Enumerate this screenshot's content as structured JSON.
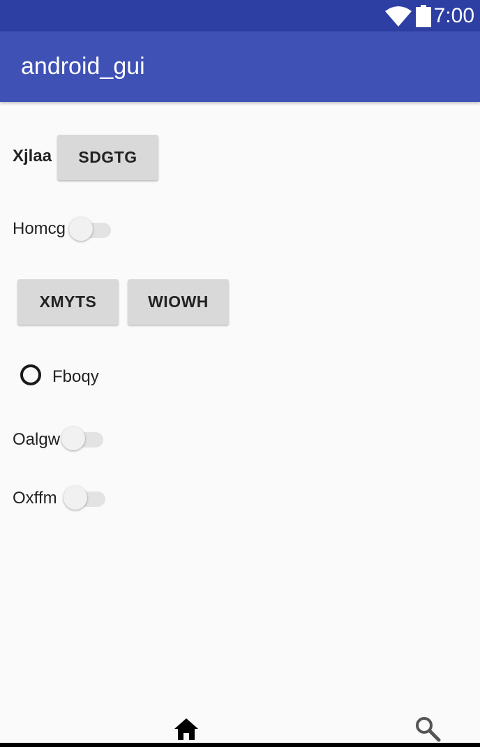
{
  "status_bar": {
    "time": "7:00",
    "icons": [
      "wifi-icon",
      "battery-icon"
    ],
    "background": "#2d3fa2"
  },
  "app_bar": {
    "title": "android_gui",
    "background": "#3f51b5"
  },
  "rows": {
    "row1": {
      "label": "Xjlaa",
      "button": "SDGTG"
    },
    "row2": {
      "label": "Homcg",
      "switch_on": false
    },
    "row3": {
      "button1": "XMYTS",
      "button2": "WIOWH"
    },
    "row4": {
      "radio_label": "Fboqy",
      "radio_checked": false
    },
    "row5": {
      "label": "Oalgw",
      "switch_on": false
    },
    "row6": {
      "label": "Oxffm",
      "switch_on": false
    }
  },
  "bottom_nav": {
    "icons": [
      "home-icon",
      "search-icon"
    ]
  }
}
